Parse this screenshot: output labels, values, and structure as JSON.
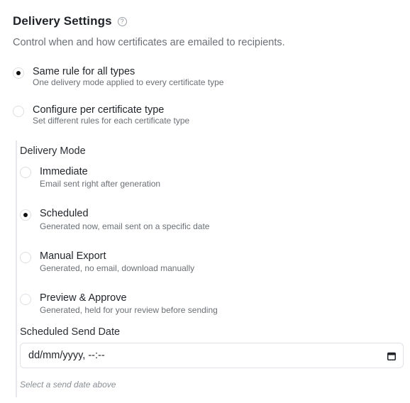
{
  "header": {
    "title": "Delivery Settings",
    "help_glyph": "?",
    "subtitle": "Control when and how certificates are emailed to recipients."
  },
  "scope_options": [
    {
      "label": "Same rule for all types",
      "description": "One delivery mode applied to every certificate type",
      "selected": true
    },
    {
      "label": "Configure per certificate type",
      "description": "Set different rules for each certificate type",
      "selected": false
    }
  ],
  "delivery_mode": {
    "label": "Delivery Mode",
    "options": [
      {
        "label": "Immediate",
        "description": "Email sent right after generation",
        "selected": false
      },
      {
        "label": "Scheduled",
        "description": "Generated now, email sent on a specific date",
        "selected": true
      },
      {
        "label": "Manual Export",
        "description": "Generated, no email, download manually",
        "selected": false
      },
      {
        "label": "Preview & Approve",
        "description": "Generated, held for your review before sending",
        "selected": false
      }
    ]
  },
  "schedule": {
    "label": "Scheduled Send Date",
    "placeholder": "dd/mm/yyyy, --:--",
    "icon": "calendar-icon",
    "hint": "Select a send date above"
  },
  "colors": {
    "text": "#1f2328",
    "muted": "#6b7075",
    "border": "#dfe2e6"
  }
}
